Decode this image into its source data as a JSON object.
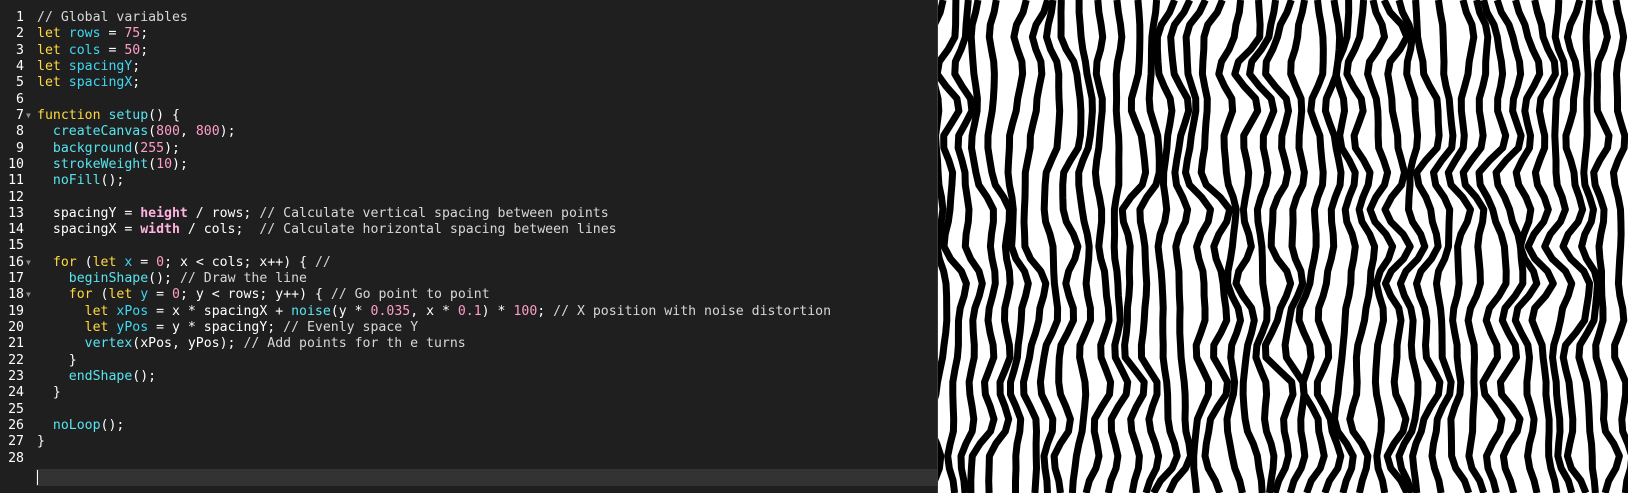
{
  "editor": {
    "lines": [
      {
        "number": "1",
        "tokens": [
          [
            "cm",
            "// Global variables"
          ]
        ]
      },
      {
        "number": "2",
        "tokens": [
          [
            "kw",
            "let "
          ],
          [
            "va",
            "rows"
          ],
          [
            "pn",
            " = "
          ],
          [
            "nm",
            "75"
          ],
          [
            "pn",
            ";"
          ]
        ]
      },
      {
        "number": "3",
        "tokens": [
          [
            "kw",
            "let "
          ],
          [
            "va",
            "cols"
          ],
          [
            "pn",
            " = "
          ],
          [
            "nm",
            "50"
          ],
          [
            "pn",
            ";"
          ]
        ]
      },
      {
        "number": "4",
        "tokens": [
          [
            "kw",
            "let "
          ],
          [
            "va",
            "spacingY"
          ],
          [
            "pn",
            ";"
          ]
        ]
      },
      {
        "number": "5",
        "tokens": [
          [
            "kw",
            "let "
          ],
          [
            "va",
            "spacingX"
          ],
          [
            "pn",
            ";"
          ]
        ]
      },
      {
        "number": "6",
        "tokens": []
      },
      {
        "number": "7",
        "fold": true,
        "tokens": [
          [
            "kw",
            "function "
          ],
          [
            "fn",
            "setup"
          ],
          [
            "pn",
            "() {"
          ]
        ]
      },
      {
        "number": "8",
        "tokens": [
          [
            "pn",
            "  "
          ],
          [
            "fn",
            "createCanvas"
          ],
          [
            "pn",
            "("
          ],
          [
            "nm",
            "800"
          ],
          [
            "pn",
            ", "
          ],
          [
            "nm",
            "800"
          ],
          [
            "pn",
            ");"
          ]
        ]
      },
      {
        "number": "9",
        "tokens": [
          [
            "pn",
            "  "
          ],
          [
            "fn",
            "background"
          ],
          [
            "pn",
            "("
          ],
          [
            "nm",
            "255"
          ],
          [
            "pn",
            ");"
          ]
        ]
      },
      {
        "number": "10",
        "tokens": [
          [
            "pn",
            "  "
          ],
          [
            "fn",
            "strokeWeight"
          ],
          [
            "pn",
            "("
          ],
          [
            "nm",
            "10"
          ],
          [
            "pn",
            ");"
          ]
        ]
      },
      {
        "number": "11",
        "tokens": [
          [
            "pn",
            "  "
          ],
          [
            "fn",
            "noFill"
          ],
          [
            "pn",
            "();"
          ]
        ]
      },
      {
        "number": "12",
        "tokens": []
      },
      {
        "number": "13",
        "tokens": [
          [
            "pn",
            "  spacingY = "
          ],
          [
            "bi",
            "height"
          ],
          [
            "pn",
            " / rows; "
          ],
          [
            "cm",
            "// Calculate vertical spacing between points"
          ]
        ]
      },
      {
        "number": "14",
        "tokens": [
          [
            "pn",
            "  spacingX = "
          ],
          [
            "bi",
            "width"
          ],
          [
            "pn",
            " / cols;  "
          ],
          [
            "cm",
            "// Calculate horizontal spacing between lines"
          ]
        ]
      },
      {
        "number": "15",
        "tokens": []
      },
      {
        "number": "16",
        "fold": true,
        "tokens": [
          [
            "pn",
            "  "
          ],
          [
            "kw",
            "for"
          ],
          [
            "pn",
            " ("
          ],
          [
            "kw",
            "let "
          ],
          [
            "va",
            "x"
          ],
          [
            "pn",
            " = "
          ],
          [
            "nm",
            "0"
          ],
          [
            "pn",
            "; x < cols; x++) { "
          ],
          [
            "cm",
            "//"
          ]
        ]
      },
      {
        "number": "17",
        "tokens": [
          [
            "pn",
            "    "
          ],
          [
            "fn",
            "beginShape"
          ],
          [
            "pn",
            "(); "
          ],
          [
            "cm",
            "// Draw the line"
          ]
        ]
      },
      {
        "number": "18",
        "fold": true,
        "tokens": [
          [
            "pn",
            "    "
          ],
          [
            "kw",
            "for"
          ],
          [
            "pn",
            " ("
          ],
          [
            "kw",
            "let "
          ],
          [
            "va",
            "y"
          ],
          [
            "pn",
            " = "
          ],
          [
            "nm",
            "0"
          ],
          [
            "pn",
            "; y < rows; y++) { "
          ],
          [
            "cm",
            "// Go point to point"
          ]
        ]
      },
      {
        "number": "19",
        "tokens": [
          [
            "pn",
            "      "
          ],
          [
            "kw",
            "let "
          ],
          [
            "va",
            "xPos"
          ],
          [
            "pn",
            " = x * spacingX + "
          ],
          [
            "fn",
            "noise"
          ],
          [
            "pn",
            "(y * "
          ],
          [
            "nm",
            "0.035"
          ],
          [
            "pn",
            ", x * "
          ],
          [
            "nm",
            "0.1"
          ],
          [
            "pn",
            ") * "
          ],
          [
            "nm",
            "100"
          ],
          [
            "pn",
            "; "
          ],
          [
            "cm",
            "// X position with noise distortion"
          ]
        ]
      },
      {
        "number": "20",
        "tokens": [
          [
            "pn",
            "      "
          ],
          [
            "kw",
            "let "
          ],
          [
            "va",
            "yPos"
          ],
          [
            "pn",
            " = y * spacingY; "
          ],
          [
            "cm",
            "// Evenly space Y"
          ]
        ]
      },
      {
        "number": "21",
        "tokens": [
          [
            "pn",
            "      "
          ],
          [
            "fn",
            "vertex"
          ],
          [
            "pn",
            "(xPos, yPos); "
          ],
          [
            "cm",
            "// Add points for th e turns"
          ]
        ]
      },
      {
        "number": "22",
        "tokens": [
          [
            "pn",
            "    }"
          ]
        ]
      },
      {
        "number": "23",
        "tokens": [
          [
            "pn",
            "    "
          ],
          [
            "fn",
            "endShape"
          ],
          [
            "pn",
            "();"
          ]
        ]
      },
      {
        "number": "24",
        "tokens": [
          [
            "pn",
            "  }"
          ]
        ]
      },
      {
        "number": "25",
        "tokens": []
      },
      {
        "number": "26",
        "tokens": [
          [
            "pn",
            "  "
          ],
          [
            "fn",
            "noLoop"
          ],
          [
            "pn",
            "();"
          ]
        ]
      },
      {
        "number": "27",
        "tokens": [
          [
            "pn",
            "}"
          ]
        ]
      },
      {
        "number": "28",
        "tokens": [],
        "current": true
      }
    ]
  },
  "preview": {
    "background": "#ffffff",
    "stroke": "#000000",
    "sketch": {
      "rows": 75,
      "cols": 50,
      "noise_y": 0.035,
      "noise_x": 0.1,
      "amplitude": 100,
      "canvas": 800
    }
  },
  "colors": {
    "editor_background": "#1f1f1f",
    "keyword": "#ffd93e",
    "variable": "#3ed8f4",
    "function": "#57e5f0",
    "number": "#ff9ec8",
    "builtin": "#ffb3e0",
    "comment": "#d7d7d7"
  }
}
